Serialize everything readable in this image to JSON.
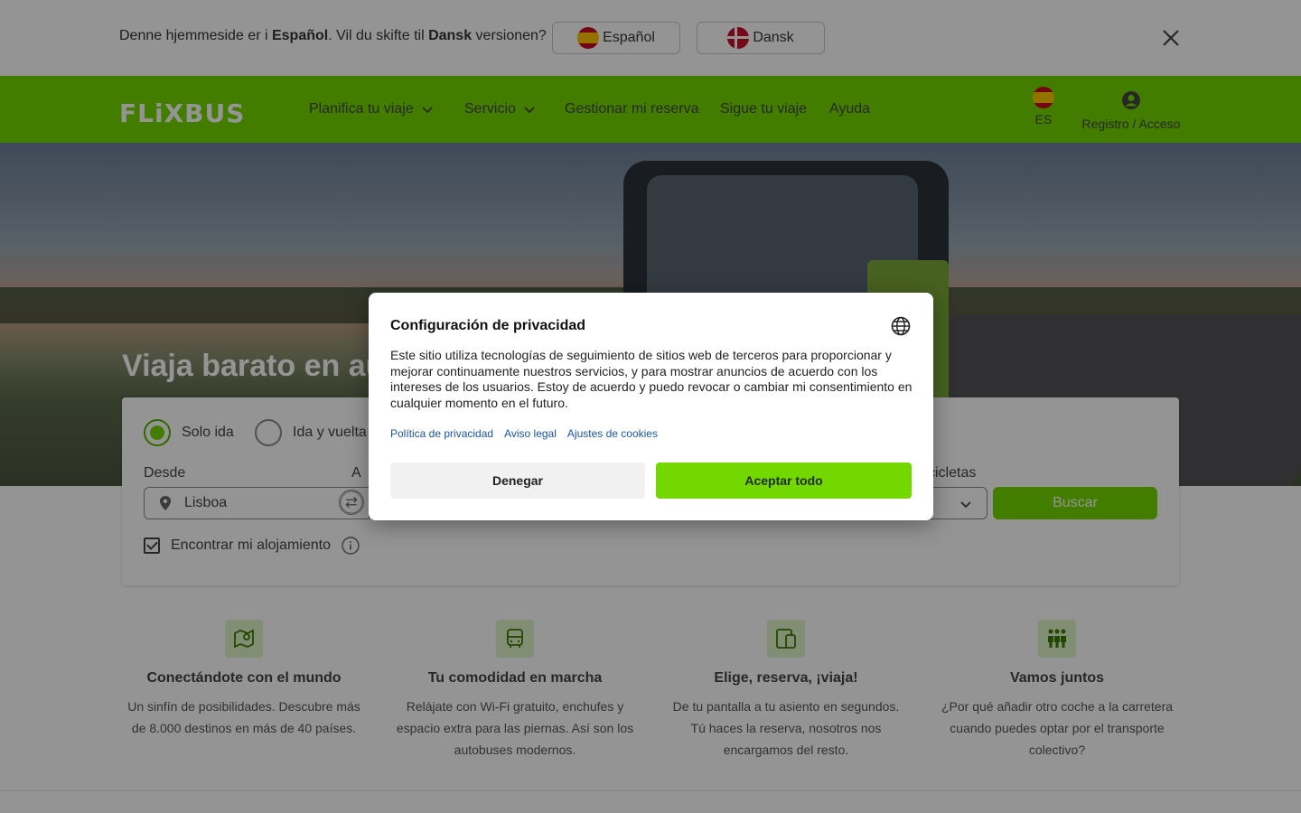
{
  "language_banner": {
    "text_prefix": "Denne hjemmeside er i ",
    "current_language": "Español",
    "text_middle": ". Vil du skifte til ",
    "target_language": "Dansk",
    "text_suffix": " versionen?",
    "spanish_button": "Español",
    "danish_button": "Dansk",
    "close_icon": "close-icon"
  },
  "header": {
    "logo": "FLiXBUS",
    "nav": [
      {
        "label": "Planifica tu viaje",
        "has_dropdown": true
      },
      {
        "label": "Servicio",
        "has_dropdown": true
      },
      {
        "label": "Gestionar mi reserva",
        "has_dropdown": false
      },
      {
        "label": "Sigue tu viaje",
        "has_dropdown": false
      },
      {
        "label": "Ayuda",
        "has_dropdown": false
      }
    ],
    "language_code": "ES",
    "account_label": "Registro / Acceso",
    "brand_color": "#73d700"
  },
  "hero": {
    "title": "Viaja barato en au"
  },
  "search": {
    "trip_types": [
      {
        "label": "Solo ida",
        "selected": true
      },
      {
        "label": "Ida y vuelta",
        "selected": false
      }
    ],
    "from_label": "Desde",
    "to_label": "A",
    "bikes_label": "cicletas",
    "from_value": "Lisboa",
    "search_button": "Buscar",
    "accommodation_label": "Encontrar mi alojamiento",
    "accommodation_checked": true
  },
  "features": [
    {
      "icon": "map-pin-icon",
      "title": "Conectándote con el mundo",
      "text": "Un sinfín de posibilidades. Descubre más de 8.000 destinos en más de 40 países."
    },
    {
      "icon": "bus-icon",
      "title": "Tu comodidad en marcha",
      "text": "Relájate con Wi-Fi gratuito, enchufes y espacio extra para las piernas. Así son los autobuses modernos."
    },
    {
      "icon": "devices-icon",
      "title": "Elige, reserva, ¡viaja!",
      "text": "De tu pantalla a tu asiento en segundos. Tú haces la reserva, nosotros nos encargamos del resto."
    },
    {
      "icon": "people-icon",
      "title": "Vamos juntos",
      "text": "¿Por qué añadir otro coche a la carretera cuando puedes optar por el transporte colectivo?"
    }
  ],
  "privacy_modal": {
    "title": "Configuración de privacidad",
    "body": "Este sitio utiliza tecnologías de seguimiento de sitios web de terceros para proporcionar y mejorar continuamente nuestros servicios, y para mostrar anuncios de acuerdo con los intereses de los usuarios. Estoy de acuerdo y puedo revocar o cambiar mi consentimiento en cualquier momento en el futuro.",
    "links": [
      "Política de privacidad",
      "Aviso legal",
      "Ajustes de cookies"
    ],
    "deny_button": "Denegar",
    "accept_button": "Aceptar todo",
    "accept_color": "#73d700"
  }
}
